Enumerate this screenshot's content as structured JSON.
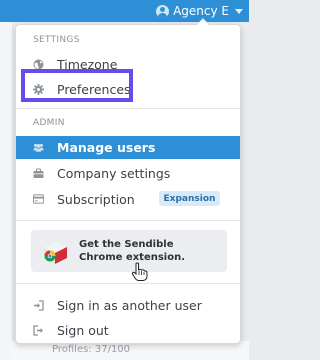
{
  "header": {
    "account_name": "Agency E"
  },
  "menu": {
    "settings_heading": "SETTINGS",
    "settings_items": [
      {
        "label": "Timezone",
        "icon": "globe-icon"
      },
      {
        "label": "Preferences",
        "icon": "gear-icon"
      }
    ],
    "admin_heading": "ADMIN",
    "admin_items": [
      {
        "label": "Manage users",
        "icon": "users-icon",
        "active": true
      },
      {
        "label": "Company settings",
        "icon": "briefcase-icon"
      },
      {
        "label": "Subscription",
        "icon": "credit-card-icon",
        "badge": "Expansion"
      }
    ],
    "chrome_extension": {
      "label": "Get the Sendible Chrome extension."
    },
    "session_items": [
      {
        "label": "Sign in as another user",
        "icon": "sign-in-icon"
      },
      {
        "label": "Sign out",
        "icon": "sign-out-icon"
      }
    ]
  },
  "background": {
    "partial_text": "Profiles: 37/100"
  },
  "colors": {
    "accent": "#2d8fd5",
    "highlight_box": "#6a4bea",
    "badge_bg": "#d8eaf8"
  }
}
